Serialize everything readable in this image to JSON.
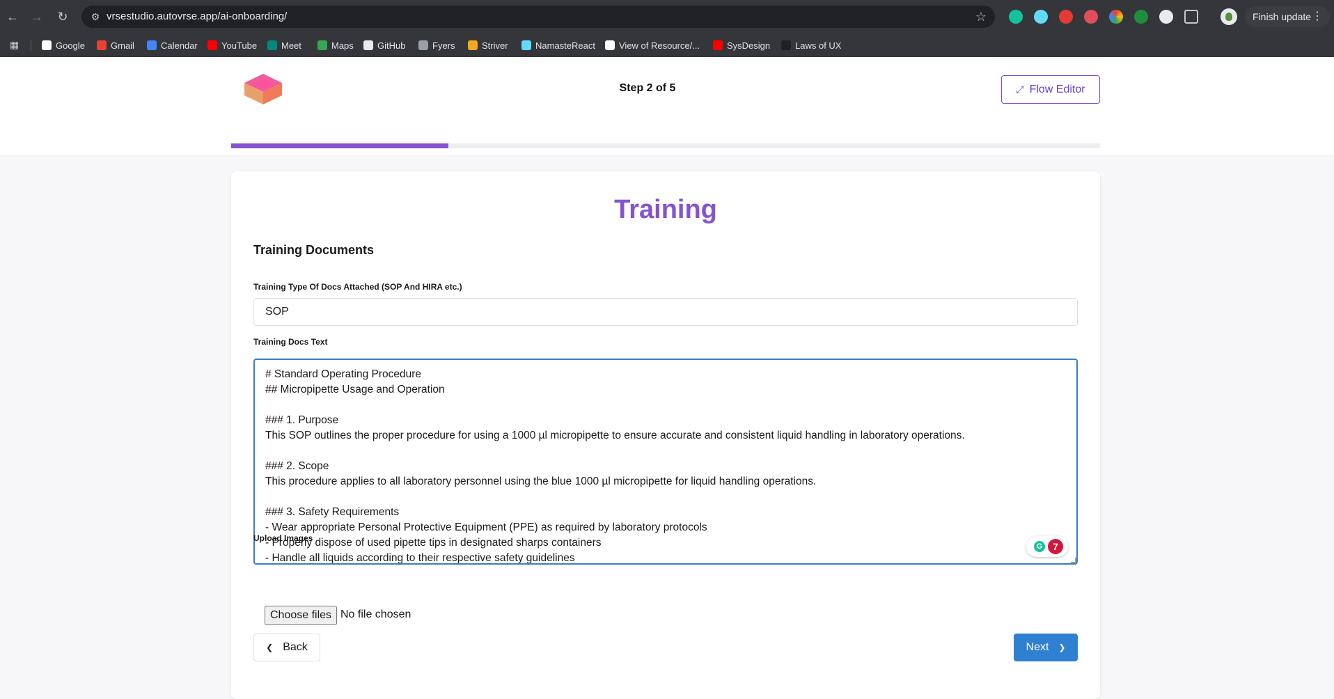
{
  "browser": {
    "url": "vrsestudio.autovrse.app/ai-onboarding/",
    "update_label": "Finish update",
    "bookmarks": [
      {
        "label": "Google",
        "color": "#ffffff"
      },
      {
        "label": "Gmail",
        "color": "#ea4335"
      },
      {
        "label": "Calendar",
        "color": "#4285f4"
      },
      {
        "label": "YouTube",
        "color": "#ff0000"
      },
      {
        "label": "Meet",
        "color": "#00897b"
      },
      {
        "label": "Maps",
        "color": "#34a853"
      },
      {
        "label": "GitHub",
        "color": "#e8eaed"
      },
      {
        "label": "Fyers",
        "color": "#9aa0a6"
      },
      {
        "label": "Striver",
        "color": "#f6a821"
      },
      {
        "label": "NamasteReact",
        "color": "#61dafb"
      },
      {
        "label": "View of Resource/...",
        "color": "#ffffff"
      },
      {
        "label": "SysDesign",
        "color": "#ff0000"
      },
      {
        "label": "Laws of UX",
        "color": "#202124"
      }
    ]
  },
  "header": {
    "step_label": "Step 2 of 5",
    "flow_editor_label": "Flow Editor",
    "progress": 0.25,
    "accent": "#8553d0"
  },
  "form": {
    "title": "Training",
    "section_title": "Training Documents",
    "type_label": "Training Type Of Docs Attached (SOP And HIRA etc.)",
    "type_value": "SOP",
    "text_label": "Training Docs Text",
    "text_lines": [
      "# Standard Operating Procedure",
      "## Micropipette Usage and Operation",
      "",
      "### 1. Purpose",
      "This SOP outlines the proper procedure for using a 1000 µl micropipette to ensure accurate and consistent liquid handling in laboratory operations.",
      "",
      "### 2. Scope",
      "This procedure applies to all laboratory personnel using the blue 1000 µl micropipette for liquid handling operations.",
      "",
      "### 3. Safety Requirements",
      "- Wear appropriate Personal Protective Equipment (PPE) as required by laboratory protocols",
      "- Properly dispose of used pipette tips in designated sharps containers",
      "- Handle all liquids according to their respective safety guidelines"
    ],
    "grammarly_count": "7",
    "upload_label": "Upload Images",
    "choose_files_label": "Choose files",
    "file_status": "No file chosen",
    "back_label": "Back",
    "next_label": "Next"
  }
}
